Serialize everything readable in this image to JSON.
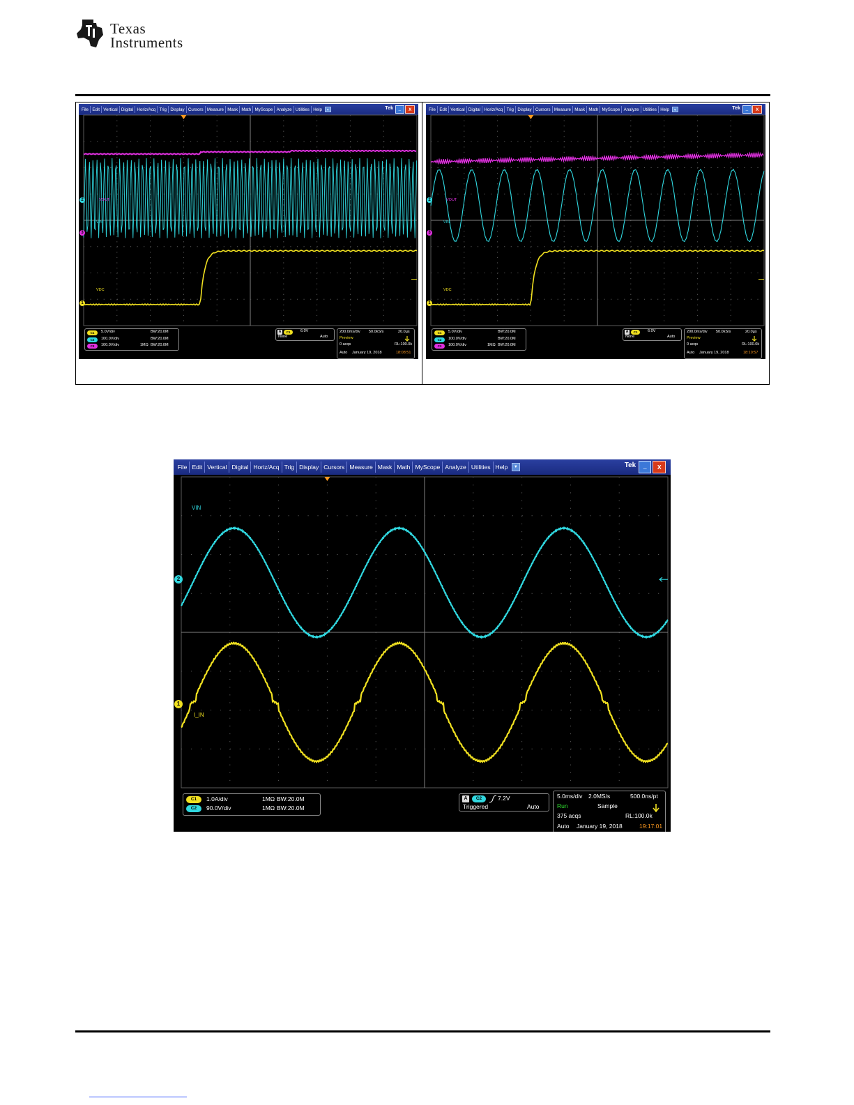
{
  "header": {
    "brand_line1": "Texas",
    "brand_line2": "Instruments"
  },
  "menu_items": [
    "File",
    "Edit",
    "Vertical",
    "Digital",
    "Horiz/Acq",
    "Trig",
    "Display",
    "Cursors",
    "Measure",
    "Mask",
    "Math",
    "MyScope",
    "Analyze",
    "Utilities",
    "Help"
  ],
  "menu_dropdown": "▼",
  "brand_tek": "Tek",
  "minimize_glyph": "_",
  "close_glyph": "X",
  "scope1": {
    "channel_labels": {
      "vout": "VOUT",
      "vin": "VIN",
      "vdc": "VDC"
    },
    "markers": [
      "2",
      "3",
      "1"
    ],
    "channels": [
      {
        "badge": "C1",
        "scale": "5.0V/div",
        "imp": "",
        "bw": "BW:20.0M",
        "color": "#f0e020"
      },
      {
        "badge": "C2",
        "scale": "100.0V/div",
        "imp": "",
        "bw": "BW:20.0M",
        "color": "#30d8e0"
      },
      {
        "badge": "C3",
        "scale": "100.0V/div",
        "imp": "1MΩ",
        "bw": "BW:20.0M",
        "color": "#e030e0"
      }
    ],
    "trigger": {
      "tag": "A",
      "badge": "C1",
      "level": "6.0V",
      "mode_left": "None",
      "mode_right": "Auto"
    },
    "horiz": {
      "timebase": "200.0ms/div",
      "sample_rate": "50.0kS/s",
      "res": "20.0µs",
      "state": "Preview",
      "acqs": "0 acqs",
      "rl": "RL:100.0k",
      "mode": "Auto",
      "date": "January 19, 2018",
      "time": "18:08:51"
    }
  },
  "scope2": {
    "channel_labels": {
      "vout": "VOUT",
      "vin": "VIN",
      "vdc": "VDC"
    },
    "markers": [
      "2",
      "3",
      "1"
    ],
    "channels": [
      {
        "badge": "C1",
        "scale": "5.0V/div",
        "imp": "",
        "bw": "BW:20.0M",
        "color": "#f0e020"
      },
      {
        "badge": "C2",
        "scale": "100.0V/div",
        "imp": "",
        "bw": "BW:20.0M",
        "color": "#30d8e0"
      },
      {
        "badge": "C3",
        "scale": "100.0V/div",
        "imp": "1MΩ",
        "bw": "BW:20.0M",
        "color": "#e030e0"
      }
    ],
    "trigger": {
      "tag": "A",
      "badge": "C1",
      "level": "6.0V",
      "mode_left": "None",
      "mode_right": "Auto"
    },
    "horiz": {
      "timebase": "200.0ms/div",
      "sample_rate": "50.0kS/s",
      "res": "20.0µs",
      "state": "Preview",
      "acqs": "0 acqs",
      "rl": "RL:100.0k",
      "mode": "Auto",
      "date": "January 19, 2018",
      "time": "18:10:57"
    }
  },
  "scope3": {
    "channel_labels": {
      "vin": "VIN",
      "iin": "I_IN"
    },
    "markers": [
      "2",
      "1"
    ],
    "channels": [
      {
        "badge": "C1",
        "scale": "1.0A/div",
        "imp": "1MΩ",
        "bw": "BW:20.0M",
        "color": "#f0e020"
      },
      {
        "badge": "C2",
        "scale": "90.0V/div",
        "imp": "1MΩ",
        "bw": "BW:20.0M",
        "color": "#30d8e0"
      }
    ],
    "trigger": {
      "tag": "A",
      "badge": "C2",
      "level": "7.2V",
      "mode_left": "Triggered",
      "mode_right": "Auto"
    },
    "horiz": {
      "timebase": "5.0ms/div",
      "sample_rate": "2.0MS/s",
      "res": "500.0ns/pt",
      "state": "Run",
      "acq_mode": "Sample",
      "acqs": "375 acqs",
      "rl": "RL:100.0k",
      "mode": "Auto",
      "date": "January 19, 2018",
      "time": "19:17:01"
    }
  },
  "colors": {
    "ch1": "#f0e020",
    "ch2": "#30d8e0",
    "ch3": "#e030e0",
    "menubar": "#22368f",
    "time": "#ff9a20",
    "run": "#30e030",
    "grid": "#5a5a5a"
  }
}
